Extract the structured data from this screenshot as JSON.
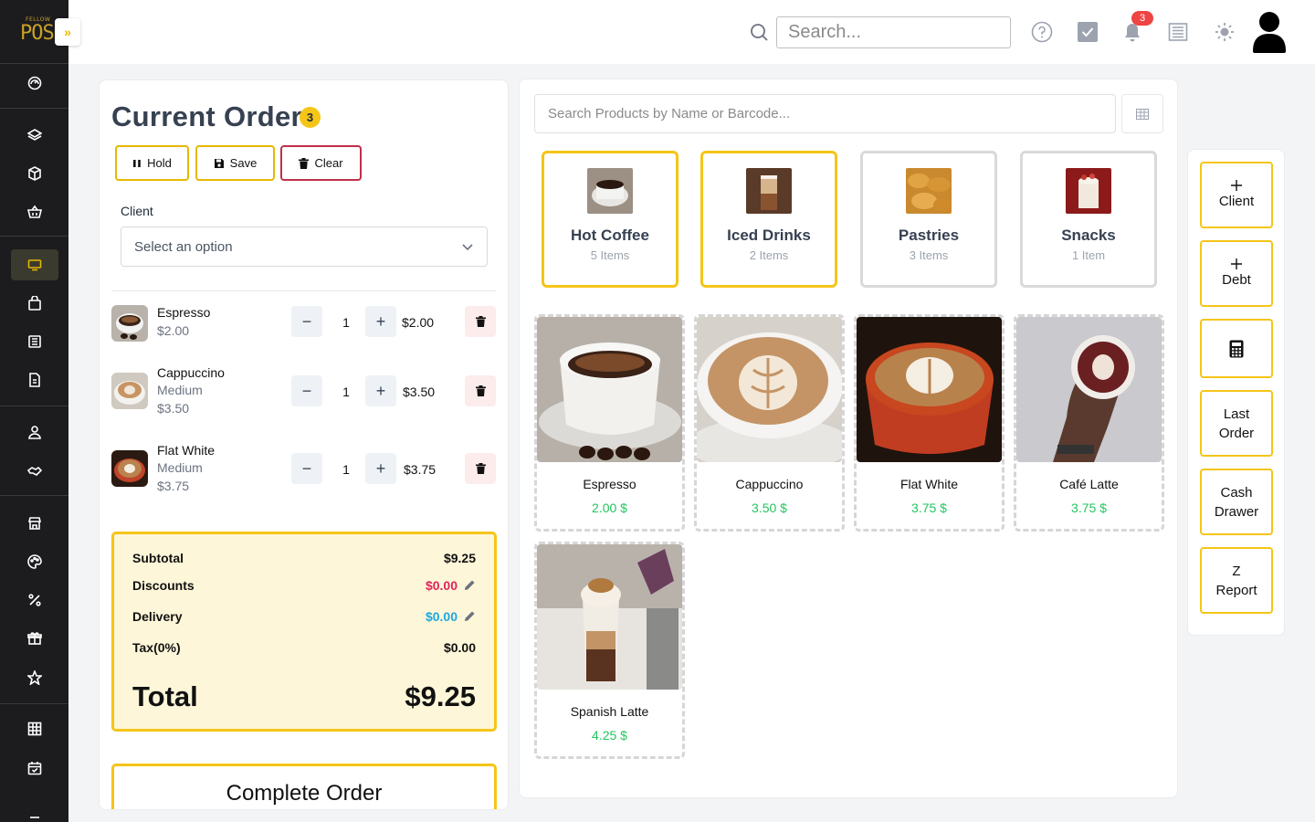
{
  "app": {
    "logo_top": "FELLOW",
    "logo_main": "POS"
  },
  "topbar": {
    "search_placeholder": "Search...",
    "notification_count": "3"
  },
  "order": {
    "title": "Current Order",
    "count": "3",
    "hold_label": "Hold",
    "save_label": "Save",
    "clear_label": "Clear",
    "client_label": "Client",
    "client_value": "Select an option",
    "items": [
      {
        "name": "Espresso",
        "variant": "",
        "unit_price": "$2.00",
        "qty": "1",
        "total": "$2.00"
      },
      {
        "name": "Cappuccino",
        "variant": "Medium",
        "unit_price": "$3.50",
        "qty": "1",
        "total": "$3.50"
      },
      {
        "name": "Flat White",
        "variant": "Medium",
        "unit_price": "$3.75",
        "qty": "1",
        "total": "$3.75"
      }
    ],
    "subtotal_label": "Subtotal",
    "subtotal": "$9.25",
    "discounts_label": "Discounts",
    "discounts": "$0.00",
    "delivery_label": "Delivery",
    "delivery": "$0.00",
    "tax_label": "Tax(0%)",
    "tax": "$0.00",
    "total_label": "Total",
    "total": "$9.25",
    "complete_label": "Complete Order"
  },
  "products": {
    "search_placeholder": "Search Products by Name or Barcode...",
    "categories": [
      {
        "name": "Hot Coffee",
        "count": "5 Items",
        "selected": true
      },
      {
        "name": "Iced Drinks",
        "count": "2 Items",
        "selected": true
      },
      {
        "name": "Pastries",
        "count": "3 Items",
        "selected": false
      },
      {
        "name": "Snacks",
        "count": "1 Item",
        "selected": false
      }
    ],
    "items": [
      {
        "name": "Espresso",
        "price": "2.00 $"
      },
      {
        "name": "Cappuccino",
        "price": "3.50 $"
      },
      {
        "name": "Flat White",
        "price": "3.75 $"
      },
      {
        "name": "Café Latte",
        "price": "3.75 $"
      },
      {
        "name": "Spanish Latte",
        "price": "4.25 $"
      }
    ]
  },
  "actions": {
    "client": "Client",
    "debt": "Debt",
    "last_order_1": "Last",
    "last_order_2": "Order",
    "cash_drawer_1": "Cash",
    "cash_drawer_2": "Drawer",
    "z_report_1": "Z",
    "z_report_2": "Report"
  },
  "colors": {
    "accent": "#f5c518",
    "danger": "#c0304a",
    "price_green": "#22c55e",
    "sidebar": "#1c1c1e"
  }
}
